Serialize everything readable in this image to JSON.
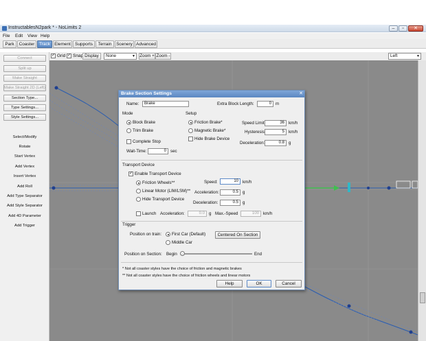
{
  "window": {
    "title": "InstructablesN2park * - NoLimits 2",
    "controls": {
      "minimize": "–",
      "maximize": "▫",
      "close": "✕"
    }
  },
  "menu": [
    "File",
    "Edit",
    "View",
    "Help"
  ],
  "tabs": [
    {
      "label": "Park",
      "active": false
    },
    {
      "label": "Coaster",
      "active": false
    },
    {
      "label": "Track",
      "active": true
    },
    {
      "label": "Element",
      "active": false
    },
    {
      "label": "Supports",
      "active": false
    },
    {
      "label": "Terrain",
      "active": false
    },
    {
      "label": "Scenery",
      "active": false
    },
    {
      "label": "Advanced",
      "active": false
    }
  ],
  "toolbar": {
    "grid_label": "Grid",
    "snap_label": "Snap",
    "display_label": "Display",
    "display_select": "None",
    "zoom_in_label": "Zoom +",
    "zoom_out_label": "Zoom -",
    "view_select": "Left"
  },
  "left_panel": {
    "buttons_disabled": [
      "Connect",
      "Split up",
      "Make Straight",
      "Make Straight 2D (Left)"
    ],
    "buttons": [
      "Section Type...",
      "Type Settings...",
      "Style Settings..."
    ],
    "select_modify": "Select/Modify",
    "tools": [
      "Rotate",
      "Start Vertex",
      "Add Vertex",
      "Insert Vertex",
      "Add Roll",
      "Add Type Separator",
      "Add Style Separator",
      "Add 4D Parameter",
      "Add Trigger"
    ]
  },
  "dialog": {
    "title": "Brake Section Settings",
    "name_label": "Name:",
    "name_value": "Brake",
    "extra_block_label": "Extra Block Length:",
    "extra_block_value": "0",
    "extra_block_unit": "m",
    "mode_heading": "Mode",
    "mode_options": [
      "Block Brake",
      "Trim Brake"
    ],
    "complete_stop_label": "Complete Stop",
    "wait_time_label": "Wait-Time:",
    "wait_time_value": "0",
    "wait_time_unit": "sec",
    "setup_heading": "Setup",
    "setup_options": [
      "Friction Brake*",
      "Magnetic Brake*"
    ],
    "hide_brake_label": "Hide Brake Device",
    "speed_limit_label": "Speed Limit:",
    "speed_limit_value": "36",
    "speed_limit_unit": "km/h",
    "hysteresis_label": "Hysteresis:",
    "hysteresis_value": "5",
    "hysteresis_unit": "km/h",
    "deceleration_label": "Deceleration:",
    "deceleration_value": "0.8",
    "deceleration_unit": "g",
    "transport_heading": "Transport Device",
    "enable_transport_label": "Enable Transport Device",
    "transport_options": [
      "Friction Wheels**",
      "Linear Motor (LIM/LSM)**",
      "Hide Transport Device"
    ],
    "t_speed_label": "Speed:",
    "t_speed_value": "10",
    "t_speed_unit": "km/h",
    "t_accel_label": "Acceleration:",
    "t_accel_value": "0.5",
    "t_accel_unit": "g",
    "t_decel_label": "Deceleration:",
    "t_decel_value": "0.5",
    "t_decel_unit": "g",
    "launch_label": "Launch",
    "launch_accel_label": "Acceleration:",
    "launch_accel_value": "0.0",
    "launch_accel_unit": "g",
    "max_speed_label": "Max.-Speed",
    "max_speed_value": "100",
    "max_speed_unit": "km/h",
    "trigger_heading": "Trigger",
    "position_on_train_label": "Position on train:",
    "train_options": [
      "First Car (Default)",
      "Middle Car"
    ],
    "centered_button": "Centered On Section",
    "position_on_section_label": "Position on Section:",
    "begin_label": "Begin",
    "end_label": "End",
    "note1": "* Not all coaster styles have the choice of friction and magnetic brakes",
    "note2": "** Not all coaster styles have the choice of friction wheels and linear motors",
    "help_button": "Help",
    "ok_button": "OK",
    "cancel_button": "Cancel"
  },
  "colors": {
    "title_blue": "#5b87c1",
    "viewport_gray": "#8a8a8a",
    "track_green": "#3fbf4f",
    "track_cyan": "#30b8c8",
    "track_blue": "#2a5db0",
    "active_tab": "#5a88c4"
  }
}
